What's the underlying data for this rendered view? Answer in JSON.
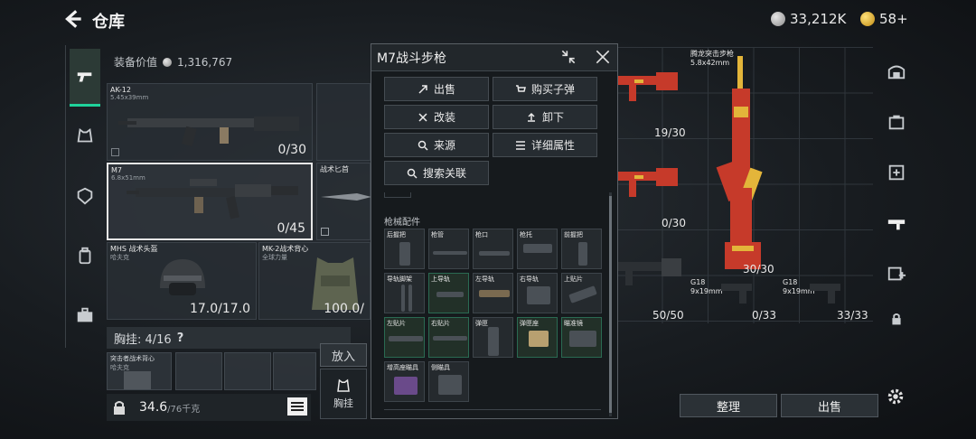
{
  "header": {
    "title": "仓库",
    "currency_silver": "33,212K",
    "currency_gold": "58+"
  },
  "equipment": {
    "value_label": "装备价值",
    "value": "1,316,767",
    "slots": [
      {
        "name": "AK-12",
        "sub": "5.45x39mm",
        "count": "0/30"
      },
      {
        "name": "M7",
        "sub": "6.8x51mm",
        "count": "0/45"
      },
      {
        "name": "战术匕首",
        "sub": "",
        "count": ""
      },
      {
        "name": "MHS 战术头盔",
        "sub": "哈夫克",
        "count": "17.0/17.0"
      },
      {
        "name": "MK-2战术背心",
        "sub": "全球力量",
        "count": "100.0/"
      }
    ],
    "chest_label": "胸挂: 4/16",
    "chest_help": "?",
    "chest_item": "突击者战术背心",
    "chest_item_sub": "哈夫克",
    "weight": "34.6",
    "weight_max": "/76千克",
    "put_label": "放入",
    "chest_btn_label": "胸挂"
  },
  "popup": {
    "title": "M7战斗步枪",
    "actions": [
      {
        "label": "出售",
        "icon": "sell-icon"
      },
      {
        "label": "购买子弹",
        "icon": "cart-icon"
      },
      {
        "label": "改装",
        "icon": "wrench-icon"
      },
      {
        "label": "卸下",
        "icon": "unload-icon"
      },
      {
        "label": "来源",
        "icon": "search-icon"
      },
      {
        "label": "详细属性",
        "icon": "list-icon"
      },
      {
        "label": "搜索关联",
        "icon": "search-icon"
      }
    ],
    "section_title": "枪械配件",
    "attachments": [
      "后握把",
      "枪管",
      "枪口",
      "枪托",
      "前握把",
      "导轨脚架",
      "上导轨",
      "左导轨",
      "右导轨",
      "上贴片",
      "左贴片",
      "右贴片",
      "弹匣",
      "弹匣座",
      "瞄准镜",
      "增高座瞄具",
      "侧瞄具"
    ]
  },
  "storage": {
    "counts": [
      "19/30",
      "0/30",
      "30/30",
      "50/50",
      "0/33",
      "33/33"
    ],
    "item_dragon_name": "腾龙突击步枪",
    "item_dragon_sub": "5.8x42mm",
    "item_g18a_name": "G18",
    "item_g18a_sub": "9x19mm",
    "item_g18b_name": "G18",
    "item_g18b_sub": "9x19mm",
    "btn_arrange": "整理",
    "btn_sell": "出售"
  },
  "colors": {
    "accent_green": "#1fd39b",
    "dragon_red": "#c63a2a",
    "dragon_gold": "#e3b53a"
  }
}
